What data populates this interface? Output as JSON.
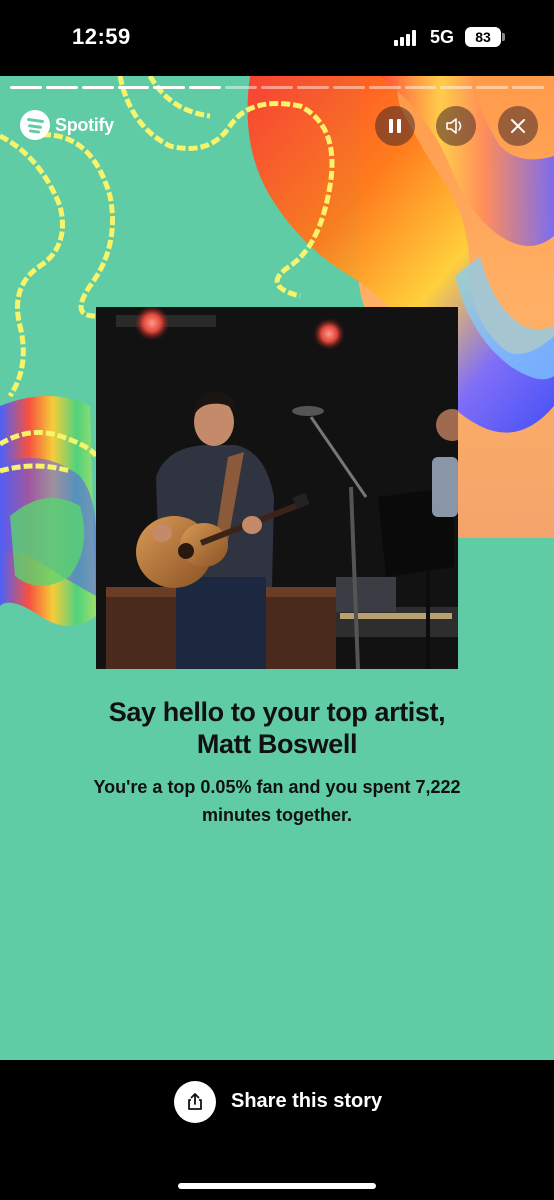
{
  "status_bar": {
    "time": "12:59",
    "network": "5G",
    "battery": "83"
  },
  "story": {
    "progress": {
      "segments_total": 15,
      "segments_completed": 6
    },
    "brand": "Spotify",
    "headline_line1": "Say hello to your top artist,",
    "headline_line2": "Matt Boswell",
    "subline_line1": "You're a top 0.05% fan and you spent 7,222",
    "subline_line2": "minutes together.",
    "background_color": "#60cca6",
    "controls": {
      "pause_icon": "pause-icon",
      "sound_icon": "speaker-icon",
      "close_icon": "close-icon"
    }
  },
  "share": {
    "label": "Share this story",
    "icon": "share-icon"
  }
}
